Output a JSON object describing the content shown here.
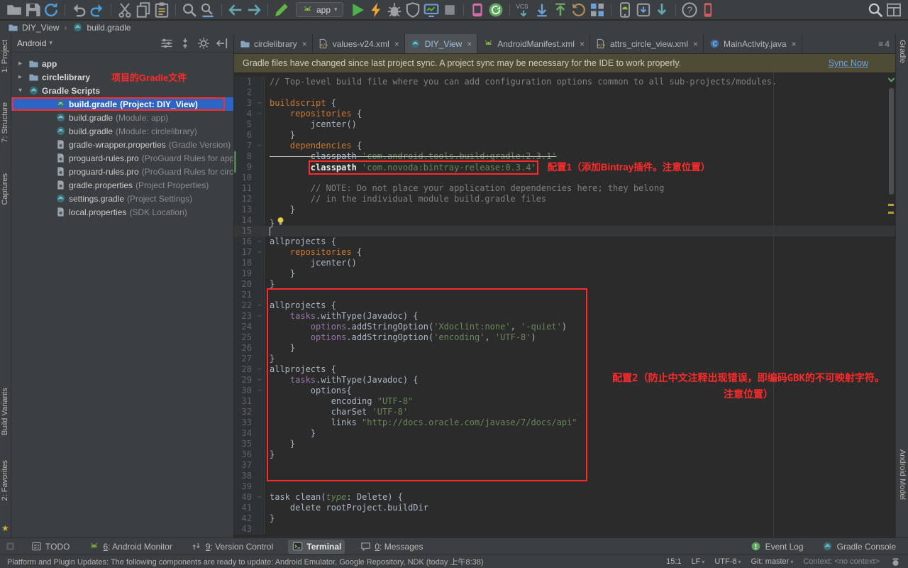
{
  "toolbar": {
    "run_config_label": "app",
    "icons_left": [
      "open-icon",
      "save-icon",
      "sync-icon",
      "|",
      "undo-icon",
      "redo-icon",
      "|",
      "cut-icon",
      "copy-icon",
      "paste-icon",
      "|",
      "find-icon",
      "replace-icon",
      "|",
      "back-icon",
      "forward-icon",
      "|",
      "make-icon"
    ],
    "icons_mid": [
      "run-icon",
      "instant-run-icon",
      "debug-icon",
      "coverage-icon",
      "profiler-icon",
      "stop-icon",
      "|",
      "android-monitor-icon",
      "gradle-sync-icon",
      "|",
      "vcs-checkout-icon",
      "vcs-update-icon",
      "vcs-commit-icon",
      "vcs-revert-icon",
      "changes-icon",
      "|",
      "avd-manager-icon",
      "sdk-manager-icon",
      "download-icon",
      "|",
      "help-icon",
      "device-icon"
    ],
    "icons_right": [
      "search-icon",
      "window-grid-icon"
    ]
  },
  "nav": {
    "crumbs": [
      {
        "label": "DIY_View",
        "icon": "folder-icon"
      },
      {
        "label": "build.gradle",
        "icon": "gradle-icon"
      }
    ]
  },
  "project": {
    "mode": "Android",
    "header_icons": [
      "sliders-icon",
      "collapse-icon",
      "gear-icon",
      "hide-icon"
    ],
    "annotation": "项目的Gradle文件",
    "items": [
      {
        "label": "app",
        "icon": "folder-icon",
        "bold": true,
        "arrow": "c",
        "level": 0
      },
      {
        "label": "circlelibrary",
        "icon": "folder-icon",
        "bold": true,
        "arrow": "c",
        "level": 0,
        "annotated": true
      },
      {
        "label": "Gradle Scripts",
        "icon": "gradle-icon",
        "bold": true,
        "arrow": "e",
        "level": 0
      },
      {
        "label": "build.gradle",
        "sub": "(Project: DIY_View)",
        "icon": "gradle-icon",
        "level": 1,
        "selected": true
      },
      {
        "label": "build.gradle",
        "sub": "(Module: app)",
        "icon": "gradle-icon",
        "level": 1
      },
      {
        "label": "build.gradle",
        "sub": "(Module: circlelibrary)",
        "icon": "gradle-icon",
        "level": 1
      },
      {
        "label": "gradle-wrapper.properties",
        "sub": "(Gradle Version)",
        "icon": "properties-icon",
        "level": 1
      },
      {
        "label": "proguard-rules.pro",
        "sub": "(ProGuard Rules for app)",
        "icon": "properties-icon",
        "level": 1
      },
      {
        "label": "proguard-rules.pro",
        "sub": "(ProGuard Rules for circlelibrary)",
        "icon": "properties-icon",
        "level": 1
      },
      {
        "label": "gradle.properties",
        "sub": "(Project Properties)",
        "icon": "properties-icon",
        "level": 1
      },
      {
        "label": "settings.gradle",
        "sub": "(Project Settings)",
        "icon": "gradle-icon",
        "level": 1
      },
      {
        "label": "local.properties",
        "sub": "(SDK Location)",
        "icon": "properties-icon",
        "level": 1
      }
    ]
  },
  "tabs": {
    "overflow_count": "4",
    "items": [
      {
        "label": "circlelibrary",
        "icon": "folder-icon"
      },
      {
        "label": "values-v24.xml",
        "icon": "xml-icon"
      },
      {
        "label": "DIY_View",
        "icon": "gradle-icon",
        "selected": true
      },
      {
        "label": "AndroidManifest.xml",
        "icon": "manifest-icon"
      },
      {
        "label": "attrs_circle_view.xml",
        "icon": "xml-icon"
      },
      {
        "label": "MainActivity.java",
        "icon": "class-icon"
      }
    ]
  },
  "notification": {
    "text": "Gradle files have changed since last project sync. A project sync may be necessary for the IDE to work properly.",
    "action": "Sync Now"
  },
  "editor": {
    "annotation1": "配置1（添加Bintray插件。注意位置）",
    "annotation2_line1": "配置2（防止中文注释出现错误，即编码GBK的不可映射字符。",
    "annotation2_line2": "注意位置）",
    "lines": [
      {
        "n": 1,
        "t": [
          [
            "c",
            "// Top-level build file where you can add configuration options common to all sub-projects/modules."
          ]
        ]
      },
      {
        "n": 2,
        "t": []
      },
      {
        "n": 3,
        "fold": true,
        "t": [
          [
            "k",
            "buildscript"
          ],
          [
            "p",
            " {"
          ]
        ]
      },
      {
        "n": 4,
        "fold": true,
        "t": [
          [
            "p",
            "    "
          ],
          [
            "k",
            "repositories"
          ],
          [
            "p",
            " {"
          ]
        ]
      },
      {
        "n": 5,
        "t": [
          [
            "p",
            "        jcenter()"
          ]
        ]
      },
      {
        "n": 6,
        "t": [
          [
            "p",
            "    }"
          ]
        ]
      },
      {
        "n": 7,
        "fold": true,
        "t": [
          [
            "p",
            "    "
          ],
          [
            "k",
            "dependencies"
          ],
          [
            "p",
            " {"
          ]
        ]
      },
      {
        "n": 8,
        "chg": true,
        "strike": true,
        "t": [
          [
            "p",
            "        classpath "
          ],
          [
            "s",
            "'com.android.tools.build:gradle:2.3.1'"
          ]
        ]
      },
      {
        "n": 9,
        "chg": true,
        "box": true,
        "ann1": true,
        "t": [
          [
            "p",
            "        "
          ],
          [
            "b",
            "classpath "
          ],
          [
            "s",
            "'com.novoda:bintray-release:0.3.4'"
          ]
        ]
      },
      {
        "n": 10,
        "t": []
      },
      {
        "n": 11,
        "t": [
          [
            "c",
            "        // NOTE: Do not place your application dependencies here; they belong"
          ]
        ]
      },
      {
        "n": 12,
        "t": [
          [
            "c",
            "        // in the individual module build.gradle files"
          ]
        ]
      },
      {
        "n": 13,
        "t": [
          [
            "p",
            "    }"
          ]
        ]
      },
      {
        "n": 14,
        "bulb": true,
        "t": [
          [
            "p",
            "}"
          ]
        ]
      },
      {
        "n": 15,
        "cur": true,
        "t": []
      },
      {
        "n": 16,
        "fold": true,
        "t": [
          [
            "p",
            "allprojects {"
          ]
        ]
      },
      {
        "n": 17,
        "fold": true,
        "t": [
          [
            "p",
            "    "
          ],
          [
            "k",
            "repositories"
          ],
          [
            "p",
            " {"
          ]
        ]
      },
      {
        "n": 18,
        "t": [
          [
            "p",
            "        jcenter()"
          ]
        ]
      },
      {
        "n": 19,
        "t": [
          [
            "p",
            "    }"
          ]
        ]
      },
      {
        "n": 20,
        "t": [
          [
            "p",
            "}"
          ]
        ]
      },
      {
        "n": 21,
        "t": []
      },
      {
        "n": 22,
        "fold": true,
        "t": [
          [
            "p",
            "allprojects {"
          ]
        ]
      },
      {
        "n": 23,
        "fold": true,
        "t": [
          [
            "p",
            "    "
          ],
          [
            "f",
            "tasks"
          ],
          [
            "p",
            ".withType(Javadoc) {"
          ]
        ]
      },
      {
        "n": 24,
        "t": [
          [
            "p",
            "        "
          ],
          [
            "f",
            "options"
          ],
          [
            "p",
            ".addStringOption("
          ],
          [
            "s",
            "'Xdoclint:none'"
          ],
          [
            "p",
            ", "
          ],
          [
            "s",
            "'-quiet'"
          ],
          [
            "p",
            ")"
          ]
        ]
      },
      {
        "n": 25,
        "t": [
          [
            "p",
            "        "
          ],
          [
            "f",
            "options"
          ],
          [
            "p",
            ".addStringOption("
          ],
          [
            "s",
            "'encoding'"
          ],
          [
            "p",
            ", "
          ],
          [
            "s",
            "'UTF-8'"
          ],
          [
            "p",
            ")"
          ]
        ]
      },
      {
        "n": 26,
        "t": [
          [
            "p",
            "    }"
          ]
        ]
      },
      {
        "n": 27,
        "t": [
          [
            "p",
            "}"
          ]
        ]
      },
      {
        "n": 28,
        "fold": true,
        "t": [
          [
            "p",
            "allprojects {"
          ]
        ]
      },
      {
        "n": 29,
        "fold": true,
        "t": [
          [
            "p",
            "    "
          ],
          [
            "f",
            "tasks"
          ],
          [
            "p",
            ".withType(Javadoc) {"
          ]
        ]
      },
      {
        "n": 30,
        "fold": true,
        "t": [
          [
            "p",
            "        options{"
          ]
        ]
      },
      {
        "n": 31,
        "t": [
          [
            "p",
            "            encoding "
          ],
          [
            "s",
            "\"UTF-8\""
          ]
        ]
      },
      {
        "n": 32,
        "t": [
          [
            "p",
            "            charSet "
          ],
          [
            "s",
            "'UTF-8'"
          ]
        ]
      },
      {
        "n": 33,
        "t": [
          [
            "p",
            "            links "
          ],
          [
            "s",
            "\"http://docs.oracle.com/javase/7/docs/api\""
          ]
        ]
      },
      {
        "n": 34,
        "t": [
          [
            "p",
            "        }"
          ]
        ]
      },
      {
        "n": 35,
        "t": [
          [
            "p",
            "    }"
          ]
        ]
      },
      {
        "n": 36,
        "t": [
          [
            "p",
            "}"
          ]
        ]
      },
      {
        "n": 37,
        "t": []
      },
      {
        "n": 38,
        "t": []
      },
      {
        "n": 39,
        "t": []
      },
      {
        "n": 40,
        "fold": true,
        "t": [
          [
            "p",
            "task clean("
          ],
          [
            "nk",
            "type"
          ],
          [
            "p",
            ": Delete) {"
          ]
        ]
      },
      {
        "n": 41,
        "t": [
          [
            "p",
            "    delete rootProject.buildDir"
          ]
        ]
      },
      {
        "n": 42,
        "t": [
          [
            "p",
            "}"
          ]
        ]
      },
      {
        "n": 43,
        "t": []
      }
    ]
  },
  "stripes": {
    "left_top": [
      "1: Project",
      "7: Structure",
      "Captures"
    ],
    "left_bottom": [
      "Build Variants",
      "2: Favorites"
    ],
    "right_top": [
      "Gradle"
    ],
    "right_bottom": [
      "Android Model"
    ]
  },
  "bottom": {
    "left": [
      {
        "label": "TODO",
        "icon": "todo-icon"
      },
      {
        "mnemonic": "6",
        "label": "Android Monitor",
        "icon": "android-icon"
      },
      {
        "mnemonic": "9",
        "label": "Version Control",
        "icon": "vcs-small-icon"
      },
      {
        "label": "Terminal",
        "icon": "terminal-icon",
        "active": true
      },
      {
        "mnemonic": "0",
        "label": "Messages",
        "icon": "messages-icon"
      }
    ],
    "right": [
      {
        "label": "Event Log",
        "icon": "event-log-icon"
      },
      {
        "label": "Gradle Console",
        "icon": "gradle-icon"
      }
    ]
  },
  "status": {
    "message": "Platform and Plugin Updates: The following components are ready to update: Android Emulator, Google Repository, NDK (today 上午8:38)",
    "position": "15:1",
    "line_sep": "LF",
    "encoding": "UTF-8",
    "vcs": "Git: master",
    "context": "Context: <no context>"
  }
}
